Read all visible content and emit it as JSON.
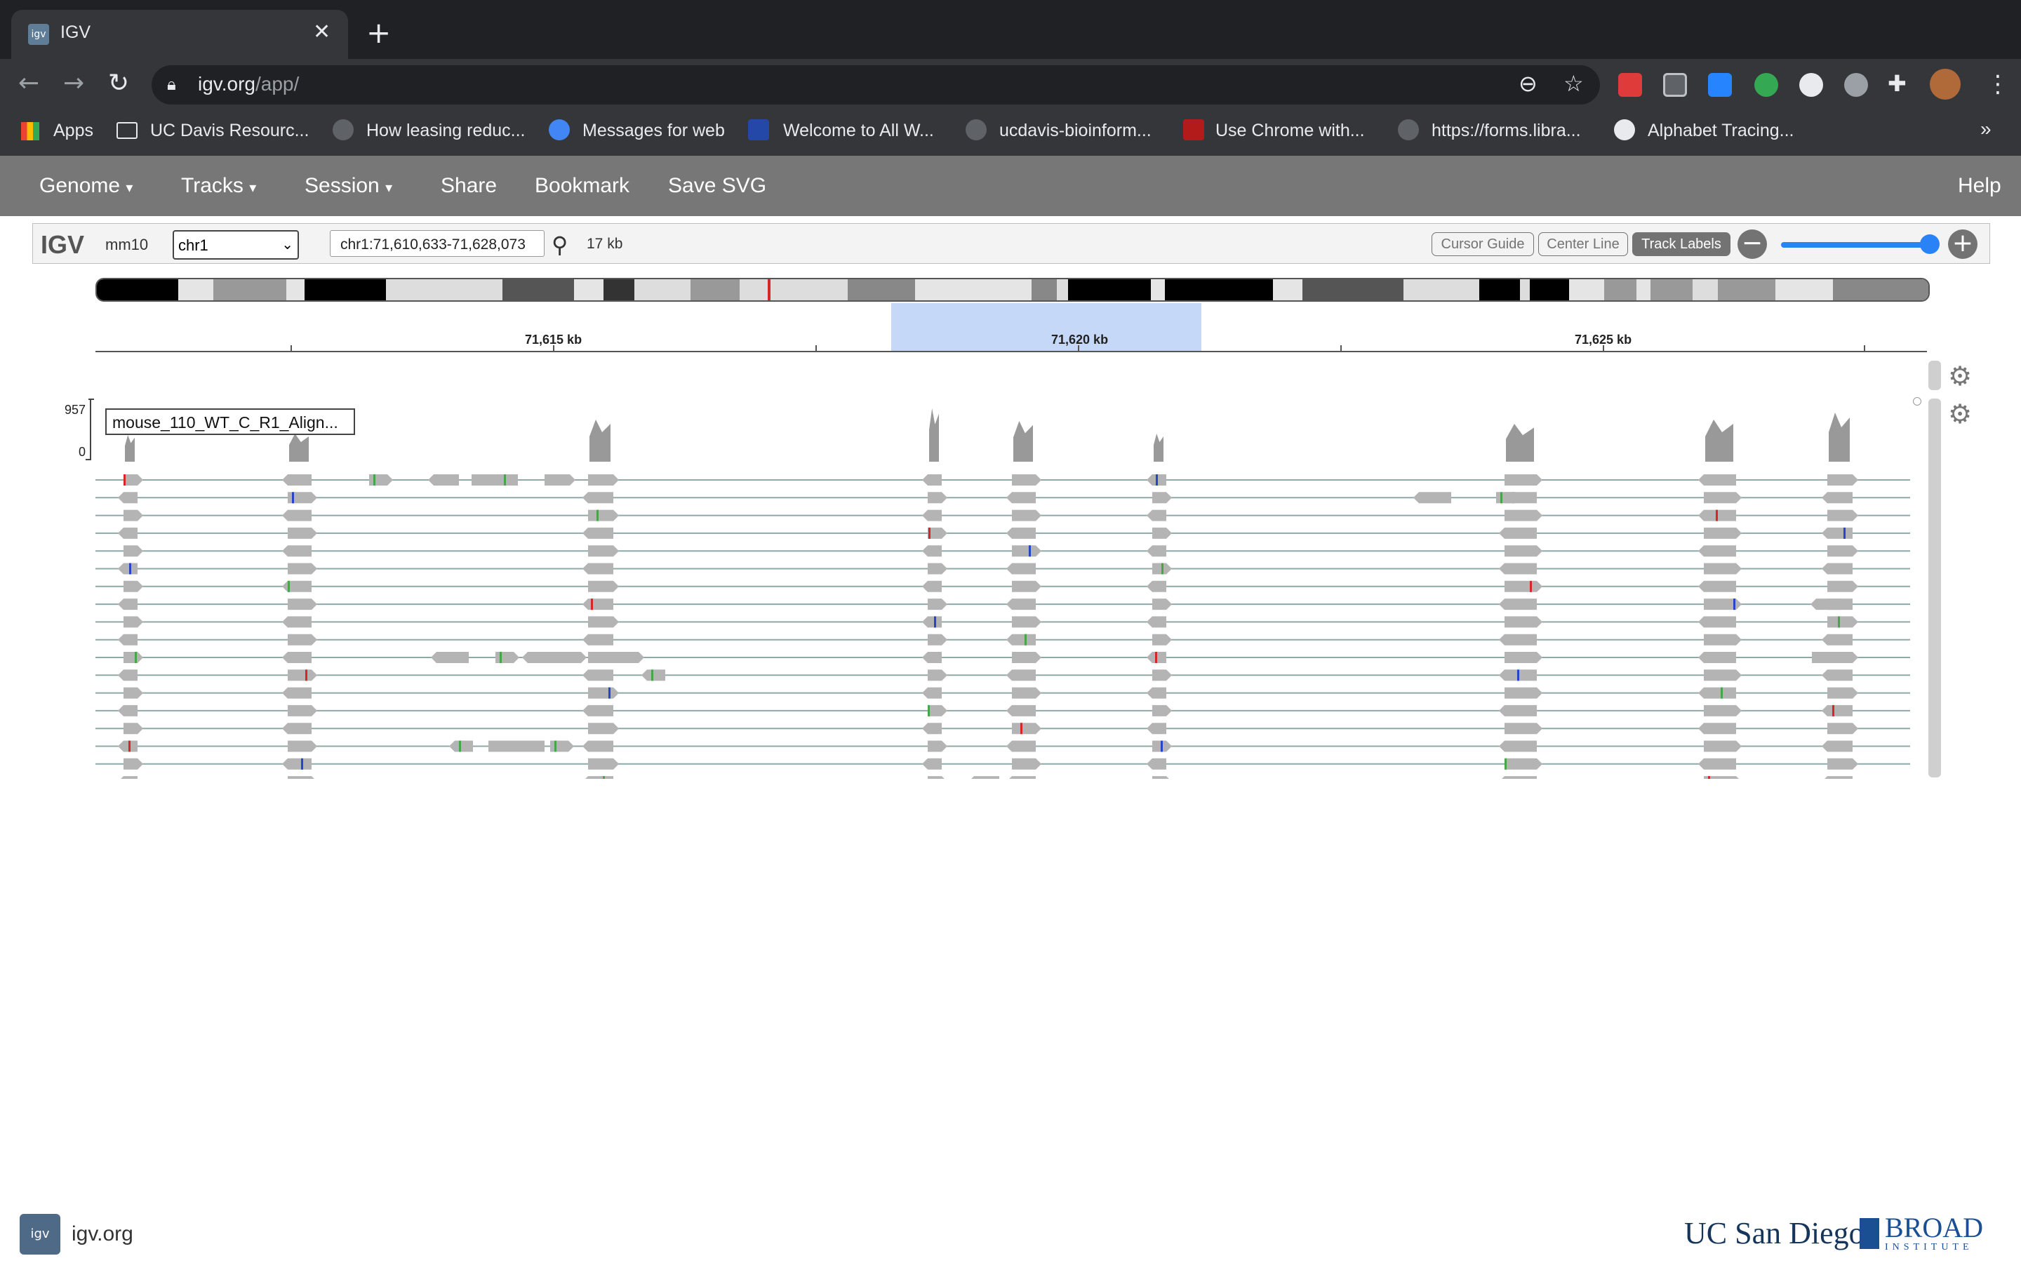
{
  "browser": {
    "tab_title": "IGV",
    "tab_favicon": "igv",
    "new_tab_label": "+",
    "url_host": "igv.org",
    "url_path": "/app/",
    "icons": [
      "back-icon",
      "forward-icon",
      "reload-icon",
      "lock-icon",
      "zoom-icon",
      "star-icon",
      "extensions-icon",
      "menu-icon"
    ],
    "bookmarks": [
      "Apps",
      "UC Davis Resourc...",
      "How leasing reduc...",
      "Messages for web",
      "Welcome to All W...",
      "ucdavis-bioinform...",
      "Use Chrome with...",
      "https://forms.libra...",
      "Alphabet Tracing..."
    ],
    "bookmarks_overflow": "»"
  },
  "igv": {
    "nav": {
      "genome": "Genome",
      "tracks": "Tracks",
      "session": "Session",
      "share": "Share",
      "bookmark": "Bookmark",
      "save_svg": "Save SVG",
      "help": "Help"
    },
    "controls": {
      "logo": "IGV",
      "genome_id": "mm10",
      "chromosome": "chr1",
      "locus": "chr1:71,610,633-71,628,073",
      "window_size": "17 kb",
      "cursor_guide": "Cursor Guide",
      "center_line": "Center Line",
      "track_labels": "Track Labels"
    },
    "ruler": {
      "labels": [
        "71,615 kb",
        "71,620 kb",
        "71,625 kb"
      ]
    },
    "track": {
      "name": "mouse_110_WT_C_R1_Align...",
      "scale_max": "957",
      "scale_min": "0"
    },
    "colors": {
      "nav_bg": "#777777",
      "read_gray": "#b4b4b4",
      "mismatch_red": "#d62728",
      "mismatch_green": "#4aa44a",
      "mismatch_blue": "#2845c8",
      "accent_blue": "#2a82f7"
    }
  },
  "footer": {
    "link": "igv.org",
    "logo1": "UC San Diego",
    "logo2": "BROAD",
    "logo2_sub": "INSTITUTE"
  }
}
